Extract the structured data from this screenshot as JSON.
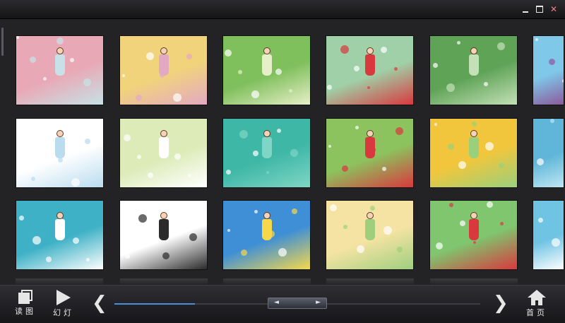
{
  "window": {
    "controls": [
      "minimize",
      "maximize",
      "close"
    ],
    "close_glyph": "✕"
  },
  "gallery": {
    "rows": 3,
    "thumbnails": [
      {
        "row": 1,
        "col": 1,
        "scene": "girl in pink with long hair, pink background",
        "colors": [
          "#e9a8b5",
          "#c6e2e6"
        ]
      },
      {
        "row": 1,
        "col": 2,
        "scene": "girl with pink flowers, yellow background",
        "colors": [
          "#f1d37c",
          "#e3a9c3"
        ]
      },
      {
        "row": 1,
        "col": 3,
        "scene": "girl in green dress among white bokeh",
        "colors": [
          "#7fbf5c",
          "#e7efc8"
        ]
      },
      {
        "row": 1,
        "col": 4,
        "scene": "girl among red mushrooms",
        "colors": [
          "#9fd0a7",
          "#d9383d"
        ]
      },
      {
        "row": 1,
        "col": 5,
        "scene": "girl with leaf umbrella, green background",
        "colors": [
          "#5fa357",
          "#c4e0b7"
        ]
      },
      {
        "row": 1,
        "col": 6,
        "scene": "partial thumbnail, blue sky",
        "colors": [
          "#7fc8e8",
          "#8b5a9e"
        ]
      },
      {
        "row": 2,
        "col": 1,
        "scene": "child reading in snow",
        "colors": [
          "#ffffff",
          "#b9dcef"
        ]
      },
      {
        "row": 2,
        "col": 2,
        "scene": "white blossoms, pale green",
        "colors": [
          "#dcebb8",
          "#ffffff"
        ]
      },
      {
        "row": 2,
        "col": 3,
        "scene": "girl with striped dress on teal",
        "colors": [
          "#3fb7a7",
          "#7fd6c4"
        ]
      },
      {
        "row": 2,
        "col": 4,
        "scene": "couple on green with red gift",
        "colors": [
          "#8cc35e",
          "#d9383d"
        ]
      },
      {
        "row": 2,
        "col": 5,
        "scene": "girl with hat on yellow field",
        "colors": [
          "#f1c63c",
          "#9ad07c"
        ]
      },
      {
        "row": 2,
        "col": 6,
        "scene": "partial thumbnail, blue sea",
        "colors": [
          "#5fb6d8",
          "#bfe6f3"
        ]
      },
      {
        "row": 3,
        "col": 1,
        "scene": "children on clouds, teal sky",
        "colors": [
          "#3fb1c6",
          "#ffffff"
        ]
      },
      {
        "row": 3,
        "col": 2,
        "scene": "child reading with cow spots",
        "colors": [
          "#ffffff",
          "#2b2b2b"
        ]
      },
      {
        "row": 3,
        "col": 3,
        "scene": "couple on yellow sun, blue sky",
        "colors": [
          "#3f8fd6",
          "#f6d84a"
        ]
      },
      {
        "row": 3,
        "col": 4,
        "scene": "small picture on pale yellow",
        "colors": [
          "#f4e3a3",
          "#9fcf7d"
        ]
      },
      {
        "row": 3,
        "col": 5,
        "scene": "girl on flower meadow",
        "colors": [
          "#7fc66f",
          "#d9383d"
        ]
      },
      {
        "row": 3,
        "col": 6,
        "scene": "partial thumbnail, clouds",
        "colors": [
          "#6fc3e3",
          "#ffffff"
        ]
      }
    ]
  },
  "toolbar": {
    "read_label": "读图",
    "slideshow_label": "幻灯",
    "home_label": "首页",
    "prev_glyph": "❮",
    "next_glyph": "❯",
    "pager_prev": "◄",
    "pager_next": "►",
    "progress_fraction": 0.22,
    "accent": "#4a8fd6"
  }
}
